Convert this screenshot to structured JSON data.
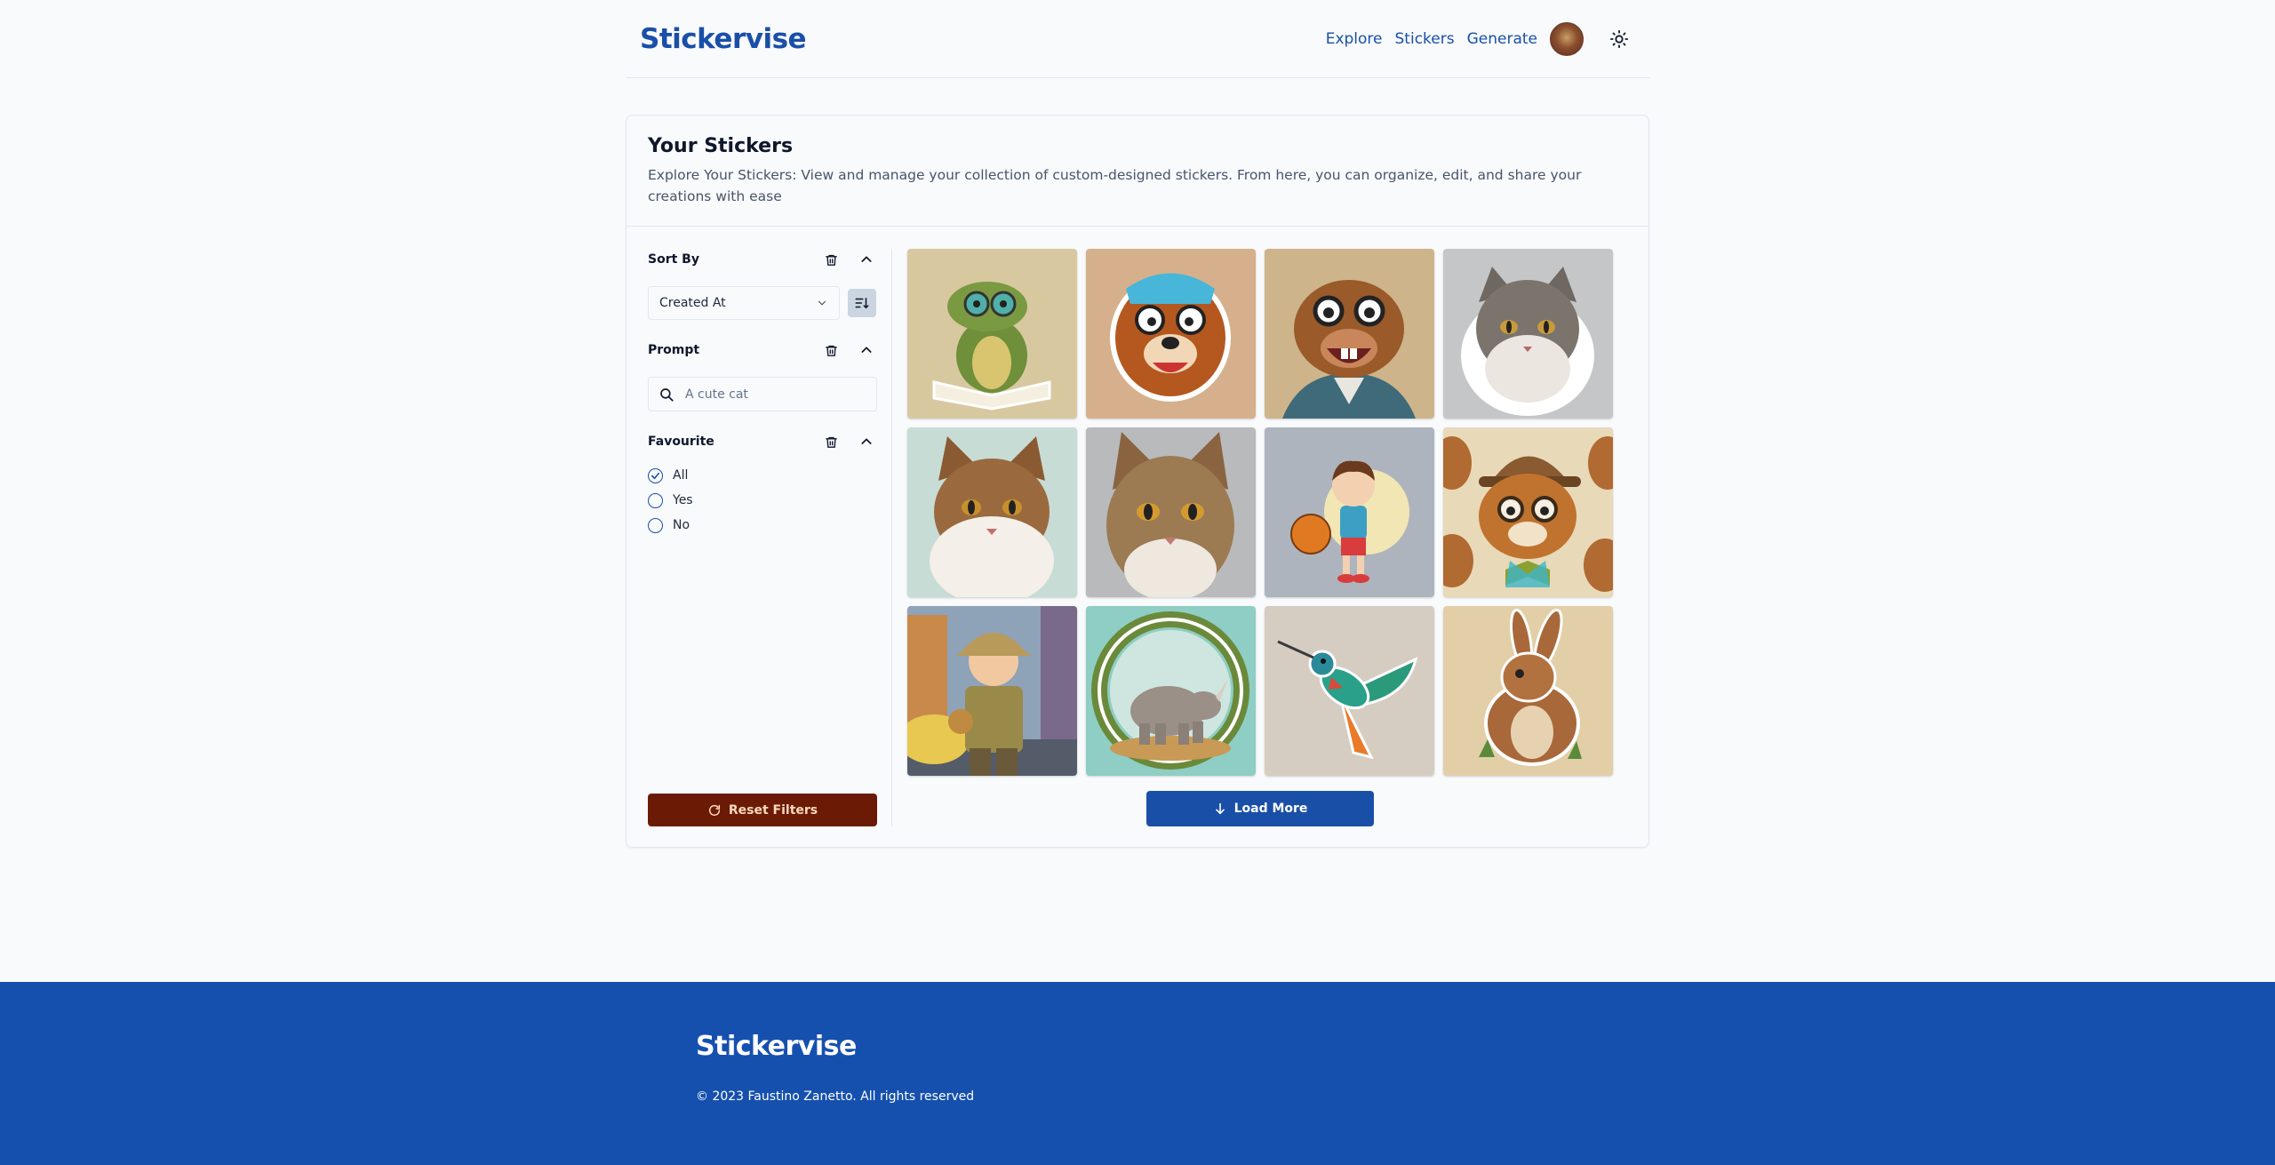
{
  "header": {
    "brand": "Stickervise",
    "nav": [
      "Explore",
      "Stickers",
      "Generate"
    ]
  },
  "page": {
    "title": "Your Stickers",
    "description": "Explore Your Stickers: View and manage your collection of custom-designed stickers. From here, you can organize, edit, and share your creations with ease"
  },
  "filters": {
    "sort_by": {
      "title": "Sort By",
      "selected": "Created At"
    },
    "prompt": {
      "title": "Prompt",
      "placeholder": "A cute cat"
    },
    "favourite": {
      "title": "Favourite",
      "options": [
        "All",
        "Yes",
        "No"
      ],
      "selected": "All"
    },
    "reset_label": "Reset Filters"
  },
  "stickers": [
    {
      "subject": "crocodile with glasses on book",
      "bg": "#d8c8a0"
    },
    {
      "subject": "dog with glasses",
      "bg": "#d6b08c"
    },
    {
      "subject": "beaver with glasses",
      "bg": "#cdb48a"
    },
    {
      "subject": "grey cat",
      "bg": "#c4c6c8"
    },
    {
      "subject": "tabby cat",
      "bg": "#c8dcd6"
    },
    {
      "subject": "tabby cat portrait",
      "bg": "#b8babc"
    },
    {
      "subject": "boy with basketball",
      "bg": "#aeb4bd"
    },
    {
      "subject": "beaver in hat",
      "bg": "#e8d9b8"
    },
    {
      "subject": "boy explorer in city",
      "bg": "#8ea2b8"
    },
    {
      "subject": "rhino in forest frame",
      "bg": "#8fcec4"
    },
    {
      "subject": "hummingbird",
      "bg": "#d6cdc2"
    },
    {
      "subject": "rabbit",
      "bg": "#e2cfa8"
    }
  ],
  "load_more_label": "Load More",
  "footer": {
    "brand": "Stickervise",
    "copyright": "© 2023 Faustino Zanetto. All rights reserved"
  },
  "colors": {
    "brand_blue": "#1a4fa8",
    "footer_blue": "#1550ae",
    "reset_bg": "#6b1b05"
  }
}
